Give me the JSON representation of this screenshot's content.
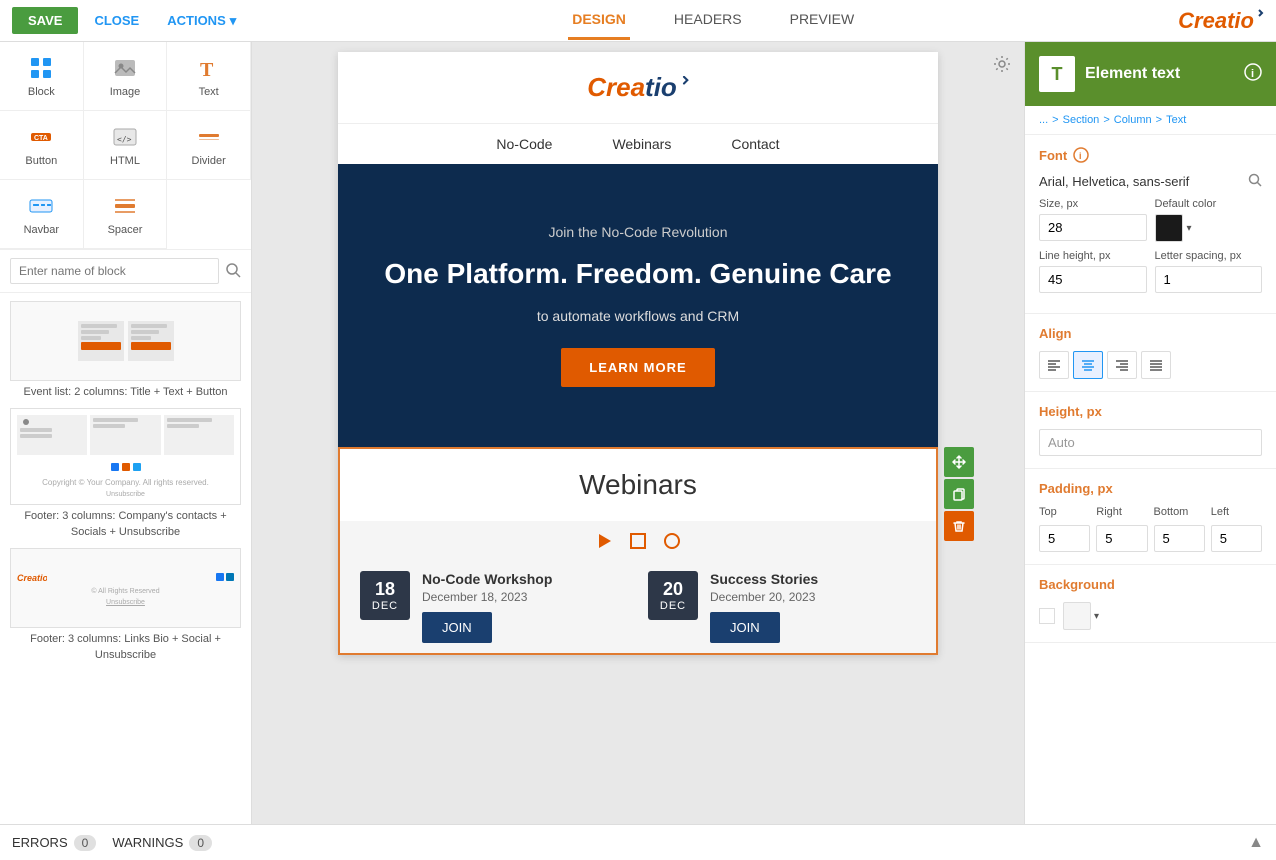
{
  "topbar": {
    "save_label": "SAVE",
    "close_label": "CLOSE",
    "actions_label": "ACTIONS",
    "tabs": [
      {
        "id": "design",
        "label": "DESIGN",
        "active": true
      },
      {
        "id": "headers",
        "label": "HEADERS",
        "active": false
      },
      {
        "id": "preview",
        "label": "PREVIEW",
        "active": false
      }
    ],
    "logo_text": "Creatio"
  },
  "sidebar": {
    "search_placeholder": "Enter name of block",
    "tools": [
      {
        "id": "block",
        "label": "Block",
        "icon": "block"
      },
      {
        "id": "image",
        "label": "Image",
        "icon": "image"
      },
      {
        "id": "text",
        "label": "Text",
        "icon": "text"
      },
      {
        "id": "button",
        "label": "Button",
        "icon": "button"
      },
      {
        "id": "html",
        "label": "HTML",
        "icon": "html"
      },
      {
        "id": "divider",
        "label": "Divider",
        "icon": "divider"
      },
      {
        "id": "navbar",
        "label": "Navbar",
        "icon": "navbar"
      },
      {
        "id": "spacer",
        "label": "Spacer",
        "icon": "spacer"
      }
    ],
    "blocks": [
      {
        "id": "event-list",
        "label": "Event list: 2 columns: Title + Text + Button"
      },
      {
        "id": "footer-contacts",
        "label": "Footer: 3 columns: Company's contacts + Socials + Unsubscribe"
      },
      {
        "id": "footer-links",
        "label": "Footer: 3 columns: Links Bio + Social + Unsubscribe"
      }
    ]
  },
  "canvas": {
    "email": {
      "logo_text": "Creatio",
      "nav_items": [
        "No-Code",
        "Webinars",
        "Contact"
      ],
      "hero": {
        "subtitle": "Join the No-Code Revolution",
        "title": "One Platform. Freedom. Genuine Care",
        "description": "to automate workflows and CRM",
        "cta_label": "LEARN MORE"
      },
      "webinars_section": {
        "title": "Webinars",
        "events": [
          {
            "day": "18",
            "month": "DEC",
            "title": "No-Code Workshop",
            "date_text": "December 18, 2023",
            "join_label": "JOIN"
          },
          {
            "day": "20",
            "month": "DEC",
            "title": "Success Stories",
            "date_text": "December 20, 2023",
            "join_label": "JOIN"
          }
        ]
      }
    }
  },
  "right_panel": {
    "element_type": "Element text",
    "breadcrumb": {
      "parts": [
        "...",
        "Section",
        "Column",
        "Text"
      ]
    },
    "font": {
      "section_label": "Font",
      "font_family": "Arial, Helvetica, sans-serif",
      "size_label": "Size, px",
      "size_value": "28",
      "default_color_label": "Default color",
      "line_height_label": "Line height, px",
      "line_height_value": "45",
      "letter_spacing_label": "Letter spacing, px",
      "letter_spacing_value": "1"
    },
    "align": {
      "section_label": "Align",
      "options": [
        "left",
        "center",
        "right",
        "justify"
      ],
      "active": "center"
    },
    "height": {
      "section_label": "Height, px",
      "value": "Auto"
    },
    "padding": {
      "section_label": "Padding, px",
      "top_label": "Top",
      "top_value": "5",
      "right_label": "Right",
      "right_value": "5",
      "bottom_label": "Bottom",
      "bottom_value": "5",
      "left_label": "Left",
      "left_value": "5"
    },
    "background": {
      "section_label": "Background"
    }
  },
  "status_bar": {
    "errors_label": "ERRORS",
    "errors_count": "0",
    "warnings_label": "WARNINGS",
    "warnings_count": "0"
  }
}
